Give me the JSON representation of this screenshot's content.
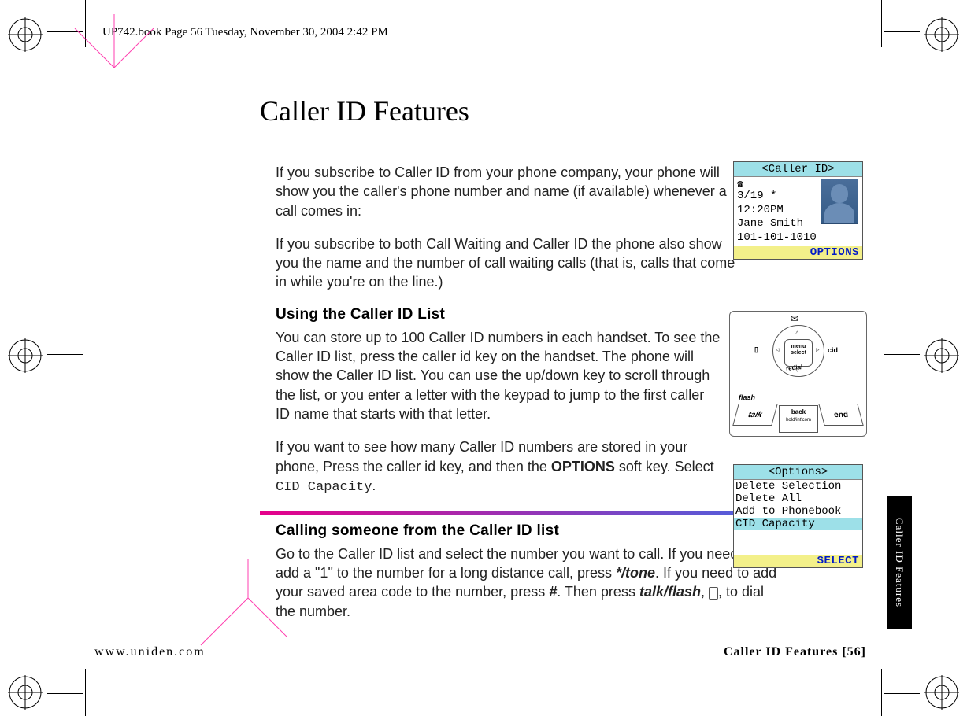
{
  "header_line": "UP742.book  Page 56  Tuesday, November 30, 2004  2:42 PM",
  "title": "Caller ID Features",
  "para1": "If you subscribe to Caller ID from your phone company, your phone will show you the caller's phone number and name (if available) whenever a call comes in:",
  "para2": "If you subscribe to both Call Waiting and Caller ID the phone also show you the name and the number of call waiting calls (that is, calls that come in while you're on the line.)",
  "sub1": "Using the Caller ID List",
  "para3": "You can store up to 100 Caller ID numbers in each handset. To see the Caller ID list, press the caller id key on the handset. The phone will show the Caller ID list. You can use the up/down key to scroll through the list, or you enter a letter with the keypad to jump to the first caller ID name that starts with that letter.",
  "para4a": "If you want to see how many Caller ID numbers are stored in your phone, Press the caller id key, and then the ",
  "para4b": "OPTIONS",
  "para4c": " soft key. Select ",
  "para4d": "CID Capacity",
  "para4e": ".",
  "sub2": "Calling someone from the Caller ID list",
  "para5a": "Go to the Caller ID list and select the number you want to call. If you need to add a \"1\" to the number for a long distance call, press  ",
  "para5b": "*/tone",
  "para5c": ". If you need to add your saved area code to the number, press ",
  "para5d": "#",
  "para5e": ". Then press ",
  "para5f": "talk/flash",
  "para5g": ", ",
  "para5h": ", to dial the number.",
  "footer_left": "www.uniden.com",
  "footer_right": "Caller ID Features [56]",
  "tab": "Caller ID Features",
  "screen1": {
    "title": "<Caller ID>",
    "lines": [
      " 3/19 *",
      "12:20PM",
      "Jane Smith",
      "101-101-1010"
    ],
    "softkey": "OPTIONS"
  },
  "screen2": {
    "title": "<Options>",
    "items": [
      "Delete Selection",
      "Delete All",
      "Add to Phonebook",
      "CID Capacity"
    ],
    "selected": 3,
    "softkey": "SELECT"
  },
  "keypad": {
    "center": "menu select",
    "left_icon": "book-icon",
    "right_label": "cid",
    "bottom_label": "redial",
    "top_icon": "mail-icon",
    "flash": "flash",
    "talk": "talk",
    "end": "end",
    "back": "back",
    "hold": "hold/int'com"
  }
}
